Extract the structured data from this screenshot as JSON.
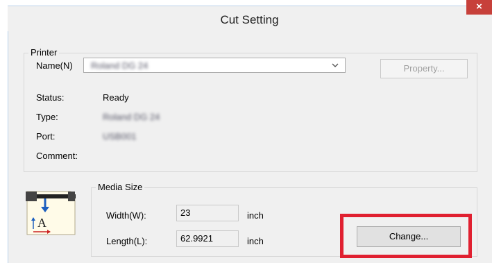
{
  "window": {
    "title": "Cut Setting",
    "close_symbol": "×"
  },
  "printer": {
    "legend": "Printer",
    "name_label": "Name(N)",
    "name_value": "Roland DG 24",
    "property_label": "Property...",
    "status_label": "Status:",
    "status_value": "Ready",
    "type_label": "Type:",
    "type_value": "Roland DG 24",
    "port_label": "Port:",
    "port_value": "USB001",
    "comment_label": "Comment:"
  },
  "media": {
    "legend": "Media Size",
    "width_label": "Width(W):",
    "width_value": "23",
    "width_unit": "inch",
    "length_label": "Length(L):",
    "length_value": "62.9921",
    "length_unit": "inch",
    "change_label": "Change..."
  },
  "colors": {
    "highlight": "#e02030",
    "close": "#c7403a",
    "icon_blue": "#1d5fbf",
    "icon_red": "#cc2222"
  }
}
